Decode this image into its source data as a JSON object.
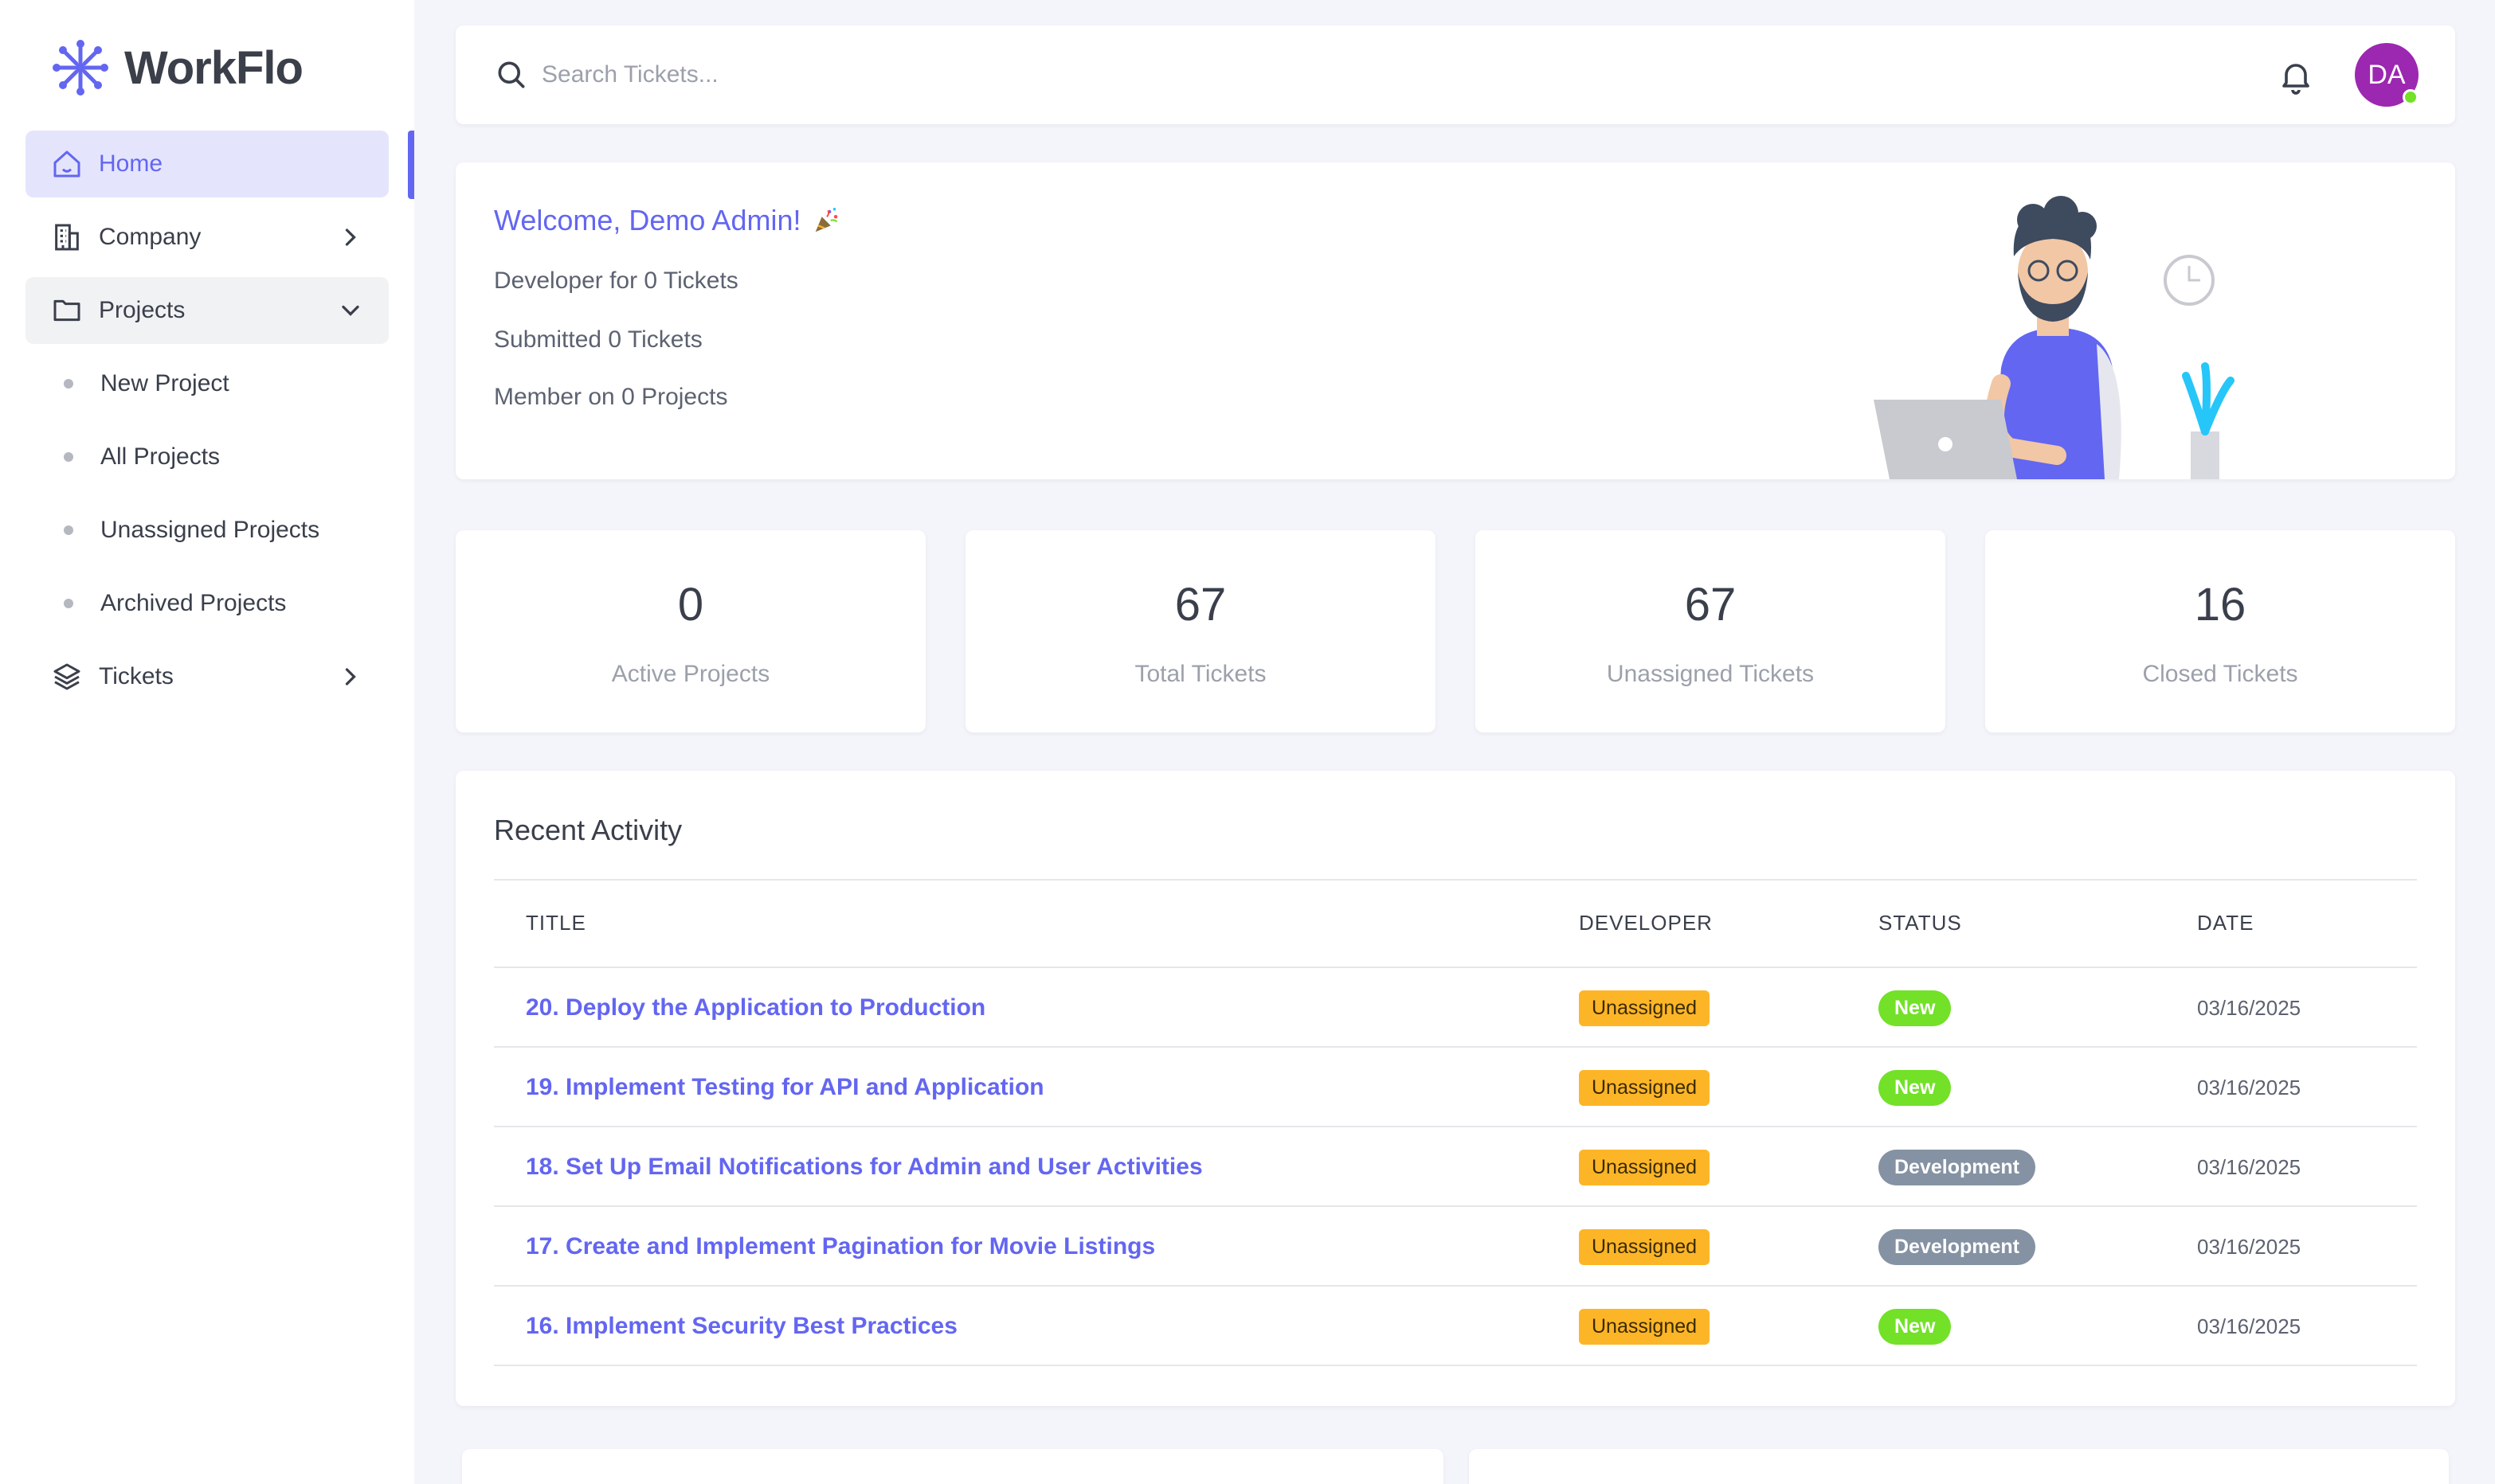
{
  "brand": {
    "name": "WorkFlo",
    "color": "#6366f1"
  },
  "sidebar": {
    "items": [
      {
        "label": "Home",
        "icon": "home-icon",
        "state": "active"
      },
      {
        "label": "Company",
        "icon": "building-icon",
        "chevron": "right"
      },
      {
        "label": "Projects",
        "icon": "folder-icon",
        "chevron": "down",
        "state": "open"
      },
      {
        "label": "Tickets",
        "icon": "layers-icon",
        "chevron": "right"
      }
    ],
    "project_sub_items": [
      "New Project",
      "All Projects",
      "Unassigned Projects",
      "Archived Projects"
    ]
  },
  "header": {
    "search_placeholder": "Search Tickets...",
    "avatar_initials": "DA",
    "avatar_color": "#9c27b0",
    "online_color": "#72e128"
  },
  "welcome": {
    "title": "Welcome, Demo Admin!",
    "title_icon": "party-popper-icon",
    "lines": [
      "Developer for 0 Tickets",
      "Submitted 0 Tickets",
      "Member on 0 Projects"
    ]
  },
  "stats": [
    {
      "value": "0",
      "label": "Active Projects"
    },
    {
      "value": "67",
      "label": "Total Tickets"
    },
    {
      "value": "67",
      "label": "Unassigned Tickets"
    },
    {
      "value": "16",
      "label": "Closed Tickets"
    }
  ],
  "activity": {
    "title": "Recent Activity",
    "columns": [
      "TITLE",
      "DEVELOPER",
      "STATUS",
      "DATE"
    ],
    "rows": [
      {
        "title": "20. Deploy the Application to Production",
        "developer": "Unassigned",
        "status": "New",
        "status_color": "#72e128",
        "date": "03/16/2025"
      },
      {
        "title": "19. Implement Testing for API and Application",
        "developer": "Unassigned",
        "status": "New",
        "status_color": "#72e128",
        "date": "03/16/2025"
      },
      {
        "title": "18. Set Up Email Notifications for Admin and User Activities",
        "developer": "Unassigned",
        "status": "Development",
        "status_color": "#8592a3",
        "date": "03/16/2025"
      },
      {
        "title": "17. Create and Implement Pagination for Movie Listings",
        "developer": "Unassigned",
        "status": "Development",
        "status_color": "#8592a3",
        "date": "03/16/2025"
      },
      {
        "title": "16. Implement Security Best Practices",
        "developer": "Unassigned",
        "status": "New",
        "status_color": "#72e128",
        "date": "03/16/2025"
      }
    ]
  }
}
